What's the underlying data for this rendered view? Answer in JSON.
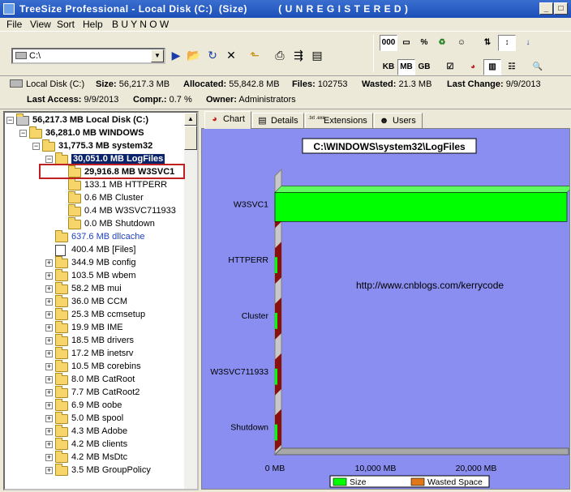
{
  "window": {
    "title": "TreeSize Professional - Local Disk (C:)  (Size)          ( U N R E G I S T E R E D )"
  },
  "menu": [
    "File",
    "View",
    "Sort",
    "Help",
    "B U Y   N O W"
  ],
  "toolbar": {
    "path_value": "C:\\",
    "unit_buttons": [
      "KB",
      "MB",
      "GB"
    ],
    "active_unit": "MB",
    "view_buttons": [
      "000",
      "%"
    ]
  },
  "info": {
    "drive": "Local Disk (C:)",
    "size_label": "Size:",
    "size_value": "56,217.3  MB",
    "allocated_label": "Allocated:",
    "allocated_value": "55,842.8  MB",
    "files_label": "Files:",
    "files_value": "102753",
    "wasted_label": "Wasted:",
    "wasted_value": "21.3  MB",
    "last_change_label": "Last Change:",
    "last_change_value": "9/9/2013",
    "last_access_label": "Last Access:",
    "last_access_value": "9/9/2013",
    "compr_label": "Compr.:",
    "compr_value": "0.7 %",
    "owner_label": "Owner:",
    "owner_value": "Administrators"
  },
  "tree": [
    {
      "text": "56,217.3  MB  Local Disk (C:)",
      "level": 0,
      "exp": "-",
      "icon": "drive",
      "style": "bold"
    },
    {
      "text": "36,281.0  MB  WINDOWS",
      "level": 1,
      "exp": "-",
      "icon": "folder",
      "style": "bold"
    },
    {
      "text": "31,775.3  MB  system32",
      "level": 2,
      "exp": "-",
      "icon": "folder",
      "style": "bold"
    },
    {
      "text": "30,051.0  MB  LogFiles",
      "level": 3,
      "exp": "-",
      "icon": "folder",
      "style": "sel"
    },
    {
      "text": "29,916.8  MB  W3SVC1",
      "level": 4,
      "exp": "",
      "icon": "folder",
      "style": "bold"
    },
    {
      "text": "133.1  MB  HTTPERR",
      "level": 4,
      "exp": "",
      "icon": "folder",
      "style": ""
    },
    {
      "text": "0.6  MB  Cluster",
      "level": 4,
      "exp": "",
      "icon": "folder",
      "style": ""
    },
    {
      "text": "0.4  MB  W3SVC711933",
      "level": 4,
      "exp": "",
      "icon": "folder",
      "style": ""
    },
    {
      "text": "0.0  MB  Shutdown",
      "level": 4,
      "exp": "",
      "icon": "folder",
      "style": ""
    },
    {
      "text": "637.6  MB  dllcache",
      "level": 3,
      "exp": "",
      "icon": "folder",
      "style": "blue"
    },
    {
      "text": "400.4  MB  [Files]",
      "level": 3,
      "exp": "",
      "icon": "file",
      "style": ""
    },
    {
      "text": "344.9  MB  config",
      "level": 3,
      "exp": "+",
      "icon": "folder",
      "style": ""
    },
    {
      "text": "103.5  MB  wbem",
      "level": 3,
      "exp": "+",
      "icon": "folder",
      "style": ""
    },
    {
      "text": "58.2  MB  mui",
      "level": 3,
      "exp": "+",
      "icon": "folder",
      "style": ""
    },
    {
      "text": "36.0  MB  CCM",
      "level": 3,
      "exp": "+",
      "icon": "folder",
      "style": ""
    },
    {
      "text": "25.3  MB  ccmsetup",
      "level": 3,
      "exp": "+",
      "icon": "folder",
      "style": ""
    },
    {
      "text": "19.9  MB  IME",
      "level": 3,
      "exp": "+",
      "icon": "folder",
      "style": ""
    },
    {
      "text": "18.5  MB  drivers",
      "level": 3,
      "exp": "+",
      "icon": "folder",
      "style": ""
    },
    {
      "text": "17.2  MB  inetsrv",
      "level": 3,
      "exp": "+",
      "icon": "folder",
      "style": ""
    },
    {
      "text": "10.5  MB  corebins",
      "level": 3,
      "exp": "+",
      "icon": "folder",
      "style": ""
    },
    {
      "text": "8.0  MB  CatRoot",
      "level": 3,
      "exp": "+",
      "icon": "folder",
      "style": ""
    },
    {
      "text": "7.7  MB  CatRoot2",
      "level": 3,
      "exp": "+",
      "icon": "folder",
      "style": ""
    },
    {
      "text": "6.9  MB  oobe",
      "level": 3,
      "exp": "+",
      "icon": "folder",
      "style": ""
    },
    {
      "text": "5.0  MB  spool",
      "level": 3,
      "exp": "+",
      "icon": "folder",
      "style": ""
    },
    {
      "text": "4.3  MB  Adobe",
      "level": 3,
      "exp": "+",
      "icon": "folder",
      "style": ""
    },
    {
      "text": "4.2  MB  clients",
      "level": 3,
      "exp": "+",
      "icon": "folder",
      "style": ""
    },
    {
      "text": "4.2  MB  MsDtc",
      "level": 3,
      "exp": "+",
      "icon": "folder",
      "style": ""
    },
    {
      "text": "3.5  MB  GroupPolicy",
      "level": 3,
      "exp": "+",
      "icon": "folder",
      "style": ""
    }
  ],
  "tabs": [
    {
      "label": "Chart",
      "icon": "pie-chart-icon",
      "active": true
    },
    {
      "label": "Details",
      "icon": "details-icon",
      "active": false
    },
    {
      "label": "Extensions",
      "icon": "extensions-icon",
      "icon_text": ".txt .exe",
      "active": false
    },
    {
      "label": "Users",
      "icon": "users-icon",
      "active": false
    }
  ],
  "chart_data": {
    "type": "bar",
    "orientation": "horizontal",
    "title": "C:\\WINDOWS\\system32\\LogFiles",
    "categories": [
      "W3SVC1",
      "HTTPERR",
      "Cluster",
      "W3SVC711933",
      "Shutdown"
    ],
    "series": [
      {
        "name": "Size",
        "values": [
          29916.8,
          133.1,
          0.6,
          0.4,
          0.0
        ],
        "color": "#00ff00"
      },
      {
        "name": "Wasted Space",
        "values": [
          0,
          0,
          0,
          0,
          0
        ],
        "color": "#e07818"
      }
    ],
    "x_ticks": [
      "0 MB",
      "10,000 MB",
      "20,000 MB"
    ],
    "xlim": [
      0,
      30000
    ],
    "annotation": "http://www.cnblogs.com/kerrycode",
    "legend": "bottom",
    "background": "#8a8ef0"
  }
}
